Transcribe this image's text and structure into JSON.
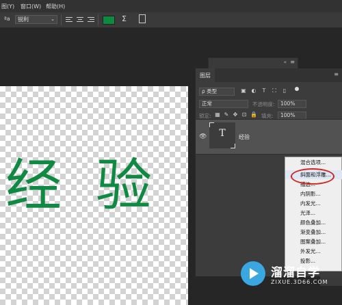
{
  "menubar": {
    "items": [
      "图(Y)",
      "窗口(W)",
      "帮助(H)"
    ]
  },
  "options_bar": {
    "aa_label": "ªa",
    "antialias_value": "锐利",
    "align_icons": [
      "align-left-icon",
      "align-center-icon",
      "align-right-icon"
    ],
    "text_color": "#0e8a3e",
    "warp_icon": "warp-text-icon",
    "panels_icon": "character-panel-icon"
  },
  "canvas": {
    "text": [
      "经",
      "验"
    ],
    "text_color": "#108a42"
  },
  "layers_panel": {
    "tab": "图层",
    "filter_label": "类型",
    "blend_mode": "正常",
    "opacity_label": "不透明度:",
    "opacity_value": "100%",
    "lock_label": "锁定:",
    "fill_label": "填充:",
    "fill_value": "100%",
    "layer": {
      "thumb_label": "T",
      "name": "经验"
    }
  },
  "context_menu": {
    "items": [
      "混合选项...",
      "斜面和浮雕...",
      "描边...",
      "内阴影...",
      "内发光...",
      "光泽...",
      "颜色叠加...",
      "渐变叠加...",
      "图案叠加...",
      "外发光...",
      "投影..."
    ]
  },
  "watermark": {
    "brand": "溜溜自学",
    "url": "ZIXUE.3D66.COM"
  }
}
